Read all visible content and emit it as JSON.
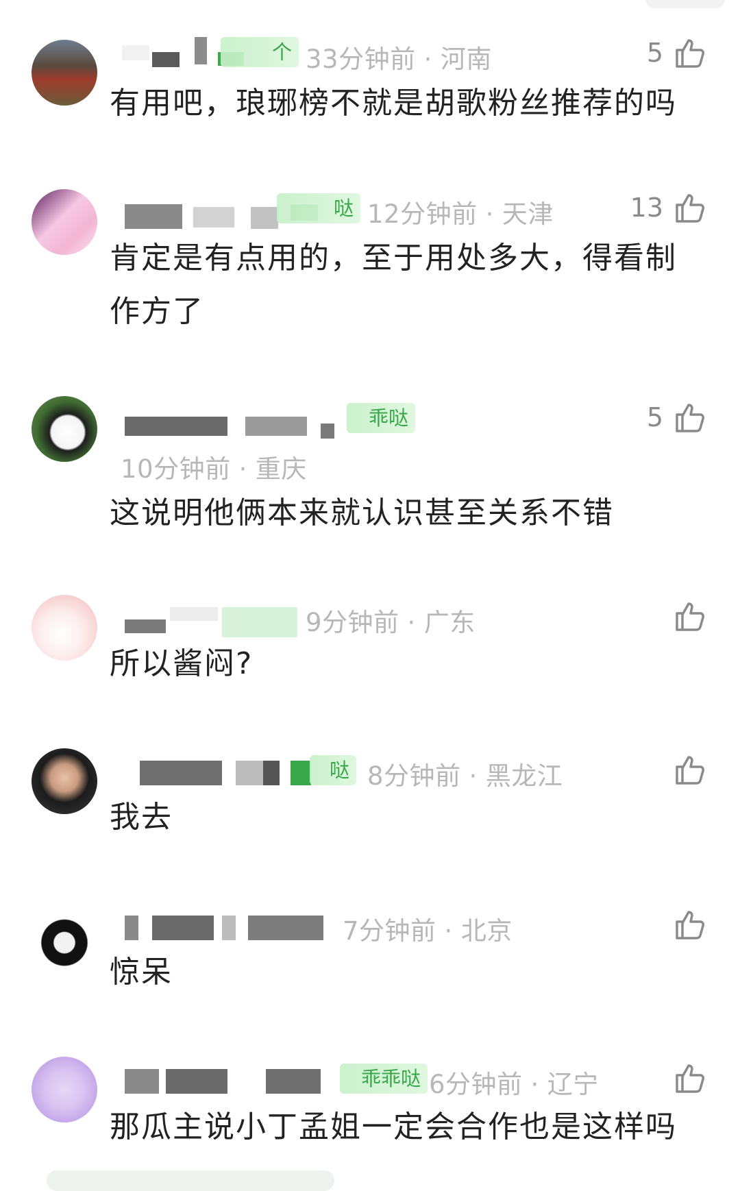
{
  "comments": [
    {
      "badge": "个",
      "time": "33分钟前",
      "location": "河南",
      "likes": "5",
      "text": "有用吧，琅琊榜不就是胡歌粉丝推荐的吗"
    },
    {
      "badge": "哒",
      "time": "12分钟前",
      "location": "天津",
      "likes": "13",
      "text": "肯定是有点用的，至于用处多大，得看制作方了"
    },
    {
      "badge": "乖哒",
      "time": "10分钟前",
      "location": "重庆",
      "likes": "5",
      "text": "这说明他俩本来就认识甚至关系不错"
    },
    {
      "badge": "",
      "time": "9分钟前",
      "location": "广东",
      "likes": "",
      "text": "所以酱闷?"
    },
    {
      "badge": "哒",
      "time": "8分钟前",
      "location": "黑龙江",
      "likes": "",
      "text": "我去"
    },
    {
      "badge": "",
      "time": "7分钟前",
      "location": "北京",
      "likes": "",
      "text": "惊呆"
    },
    {
      "badge": "乖乖哒",
      "time": "6分钟前",
      "location": "辽宁",
      "likes": "",
      "text": "那瓜主说小丁孟姐一定会合作也是这样吗"
    }
  ],
  "separator": "·",
  "icons": {
    "like": "thumbs-up-icon"
  },
  "colors": {
    "badge_text": "#3aa84a",
    "meta": "#b7b7b7",
    "text": "#222222"
  }
}
